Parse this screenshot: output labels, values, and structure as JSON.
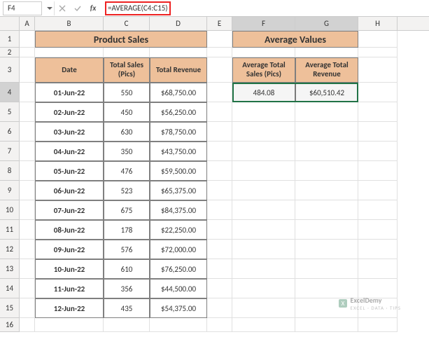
{
  "formula_bar": {
    "cell_ref": "F4",
    "formula": "=AVERAGE(C4:C15)"
  },
  "columns": [
    "A",
    "B",
    "C",
    "D",
    "E",
    "F",
    "G",
    "H"
  ],
  "rows": [
    "1",
    "2",
    "3",
    "4",
    "5",
    "6",
    "7",
    "8",
    "9",
    "10",
    "11",
    "12",
    "13",
    "14",
    "15",
    "16"
  ],
  "titles": {
    "left": "Product Sales",
    "right": "Average Values"
  },
  "headers": {
    "date": "Date",
    "sales": "Total Sales (Pics)",
    "revenue": "Total Revenue",
    "avg_sales": "Average Total Sales (Pics)",
    "avg_revenue": "Average Total Revenue"
  },
  "data": [
    {
      "date": "01-Jun-22",
      "sales": "550",
      "rev": "$68,750.00"
    },
    {
      "date": "02-Jun-22",
      "sales": "450",
      "rev": "$56,250.00"
    },
    {
      "date": "03-Jun-22",
      "sales": "630",
      "rev": "$78,750.00"
    },
    {
      "date": "04-Jun-22",
      "sales": "350",
      "rev": "$43,750.00"
    },
    {
      "date": "05-Jun-22",
      "sales": "476",
      "rev": "$59,500.00"
    },
    {
      "date": "06-Jun-22",
      "sales": "523",
      "rev": "$65,375.00"
    },
    {
      "date": "07-Jun-22",
      "sales": "675",
      "rev": "$84,375.00"
    },
    {
      "date": "08-Jun-22",
      "sales": "178",
      "rev": "$22,250.00"
    },
    {
      "date": "09-Jun-22",
      "sales": "576",
      "rev": "$72,000.00"
    },
    {
      "date": "10-Jun-22",
      "sales": "610",
      "rev": "$76,250.00"
    },
    {
      "date": "11-Jun-22",
      "sales": "356",
      "rev": "$44,500.00"
    },
    {
      "date": "12-Jun-22",
      "sales": "435",
      "rev": "$54,375.00"
    }
  ],
  "averages": {
    "sales": "484.08",
    "revenue": "$60,510.42"
  },
  "chart_data": {
    "type": "table",
    "title": "Product Sales",
    "columns": [
      "Date",
      "Total Sales (Pics)",
      "Total Revenue"
    ],
    "rows": [
      [
        "01-Jun-22",
        550,
        68750.0
      ],
      [
        "02-Jun-22",
        450,
        56250.0
      ],
      [
        "03-Jun-22",
        630,
        78750.0
      ],
      [
        "04-Jun-22",
        350,
        43750.0
      ],
      [
        "05-Jun-22",
        476,
        59500.0
      ],
      [
        "06-Jun-22",
        523,
        65375.0
      ],
      [
        "07-Jun-22",
        675,
        84375.0
      ],
      [
        "08-Jun-22",
        178,
        22250.0
      ],
      [
        "09-Jun-22",
        576,
        72000.0
      ],
      [
        "10-Jun-22",
        610,
        76250.0
      ],
      [
        "11-Jun-22",
        356,
        44500.0
      ],
      [
        "12-Jun-22",
        435,
        54375.0
      ]
    ],
    "aggregates": {
      "Average Total Sales (Pics)": 484.08,
      "Average Total Revenue": 60510.42
    }
  },
  "watermark": {
    "brand": "ExcelDemy",
    "tag": "EXCEL · DATA · TIPS"
  }
}
